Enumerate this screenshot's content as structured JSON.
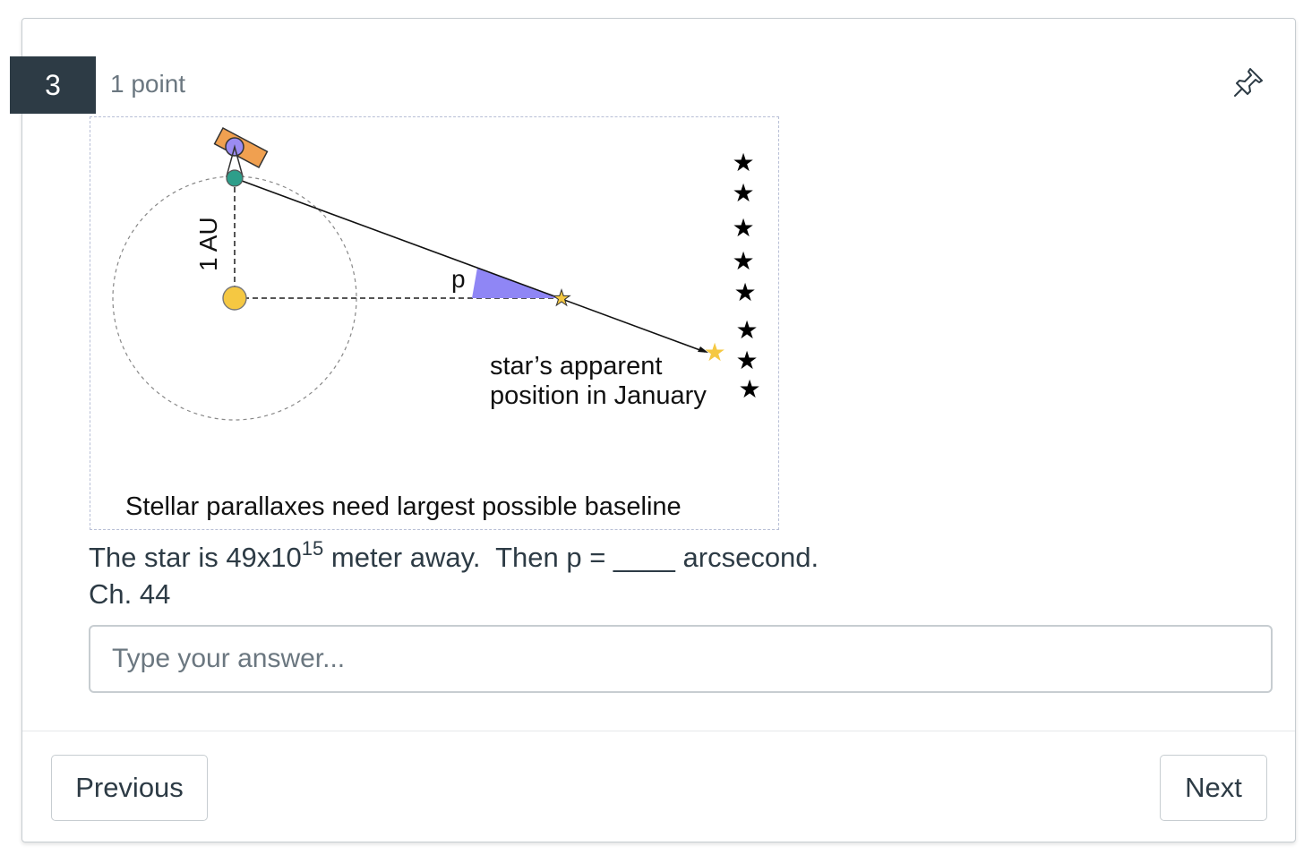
{
  "question": {
    "number": "3",
    "points": "1 point"
  },
  "figure": {
    "au_label": "1 AU",
    "p_label": "p",
    "apparent_line1": "star’s apparent",
    "apparent_line2": "position in January",
    "caption": "Stellar parallaxes need largest possible baseline",
    "colors": {
      "sun": "#f5c842",
      "earth": "#2e9e8a",
      "telescope": "#f0a050",
      "telescope_lens": "#9b8cf2",
      "parallax_wedge": "#8f86f5",
      "apparent_star": "#f5c842"
    }
  },
  "prompt": {
    "part1": "The star is 49x10",
    "exponent": "15",
    "part2": " meter away.  Then p = ____ arcsecond.",
    "chapter": "Ch. 44"
  },
  "answer": {
    "placeholder": "Type your answer...",
    "value": ""
  },
  "nav": {
    "previous_label": "Previous",
    "next_label": "Next"
  },
  "icons": {
    "pin": "pin-icon"
  }
}
